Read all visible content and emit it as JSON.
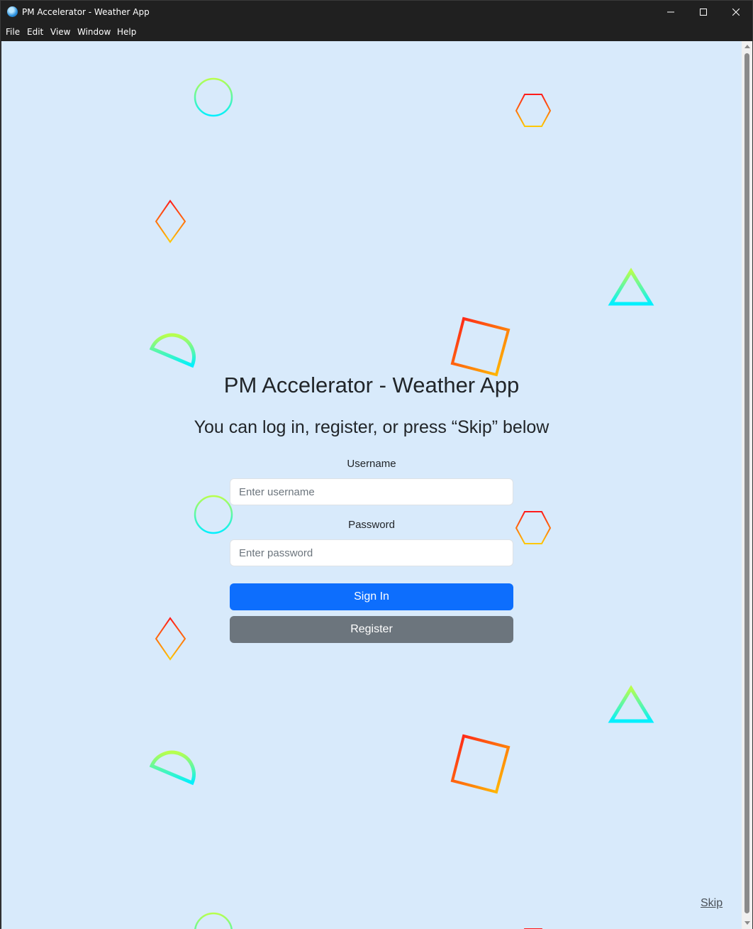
{
  "window": {
    "title": "PM Accelerator - Weather App"
  },
  "menu": {
    "items": [
      "File",
      "Edit",
      "View",
      "Window",
      "Help"
    ]
  },
  "page": {
    "heading": "PM Accelerator - Weather App",
    "subheading": "You can log in, register, or press “Skip” below",
    "username_label": "Username",
    "username_placeholder": "Enter username",
    "password_label": "Password",
    "password_placeholder": "Enter password",
    "sign_in_label": "Sign In",
    "register_label": "Register",
    "skip_label": "Skip"
  },
  "colors": {
    "background": "#d8eafb",
    "primary_button": "#0d6efd",
    "secondary_button": "#6c757d",
    "text": "#212529"
  },
  "decorations": [
    "circle-outline",
    "hexagon-outline",
    "diamond-outline",
    "triangle-outline",
    "square-outline",
    "semicircle-outline"
  ]
}
